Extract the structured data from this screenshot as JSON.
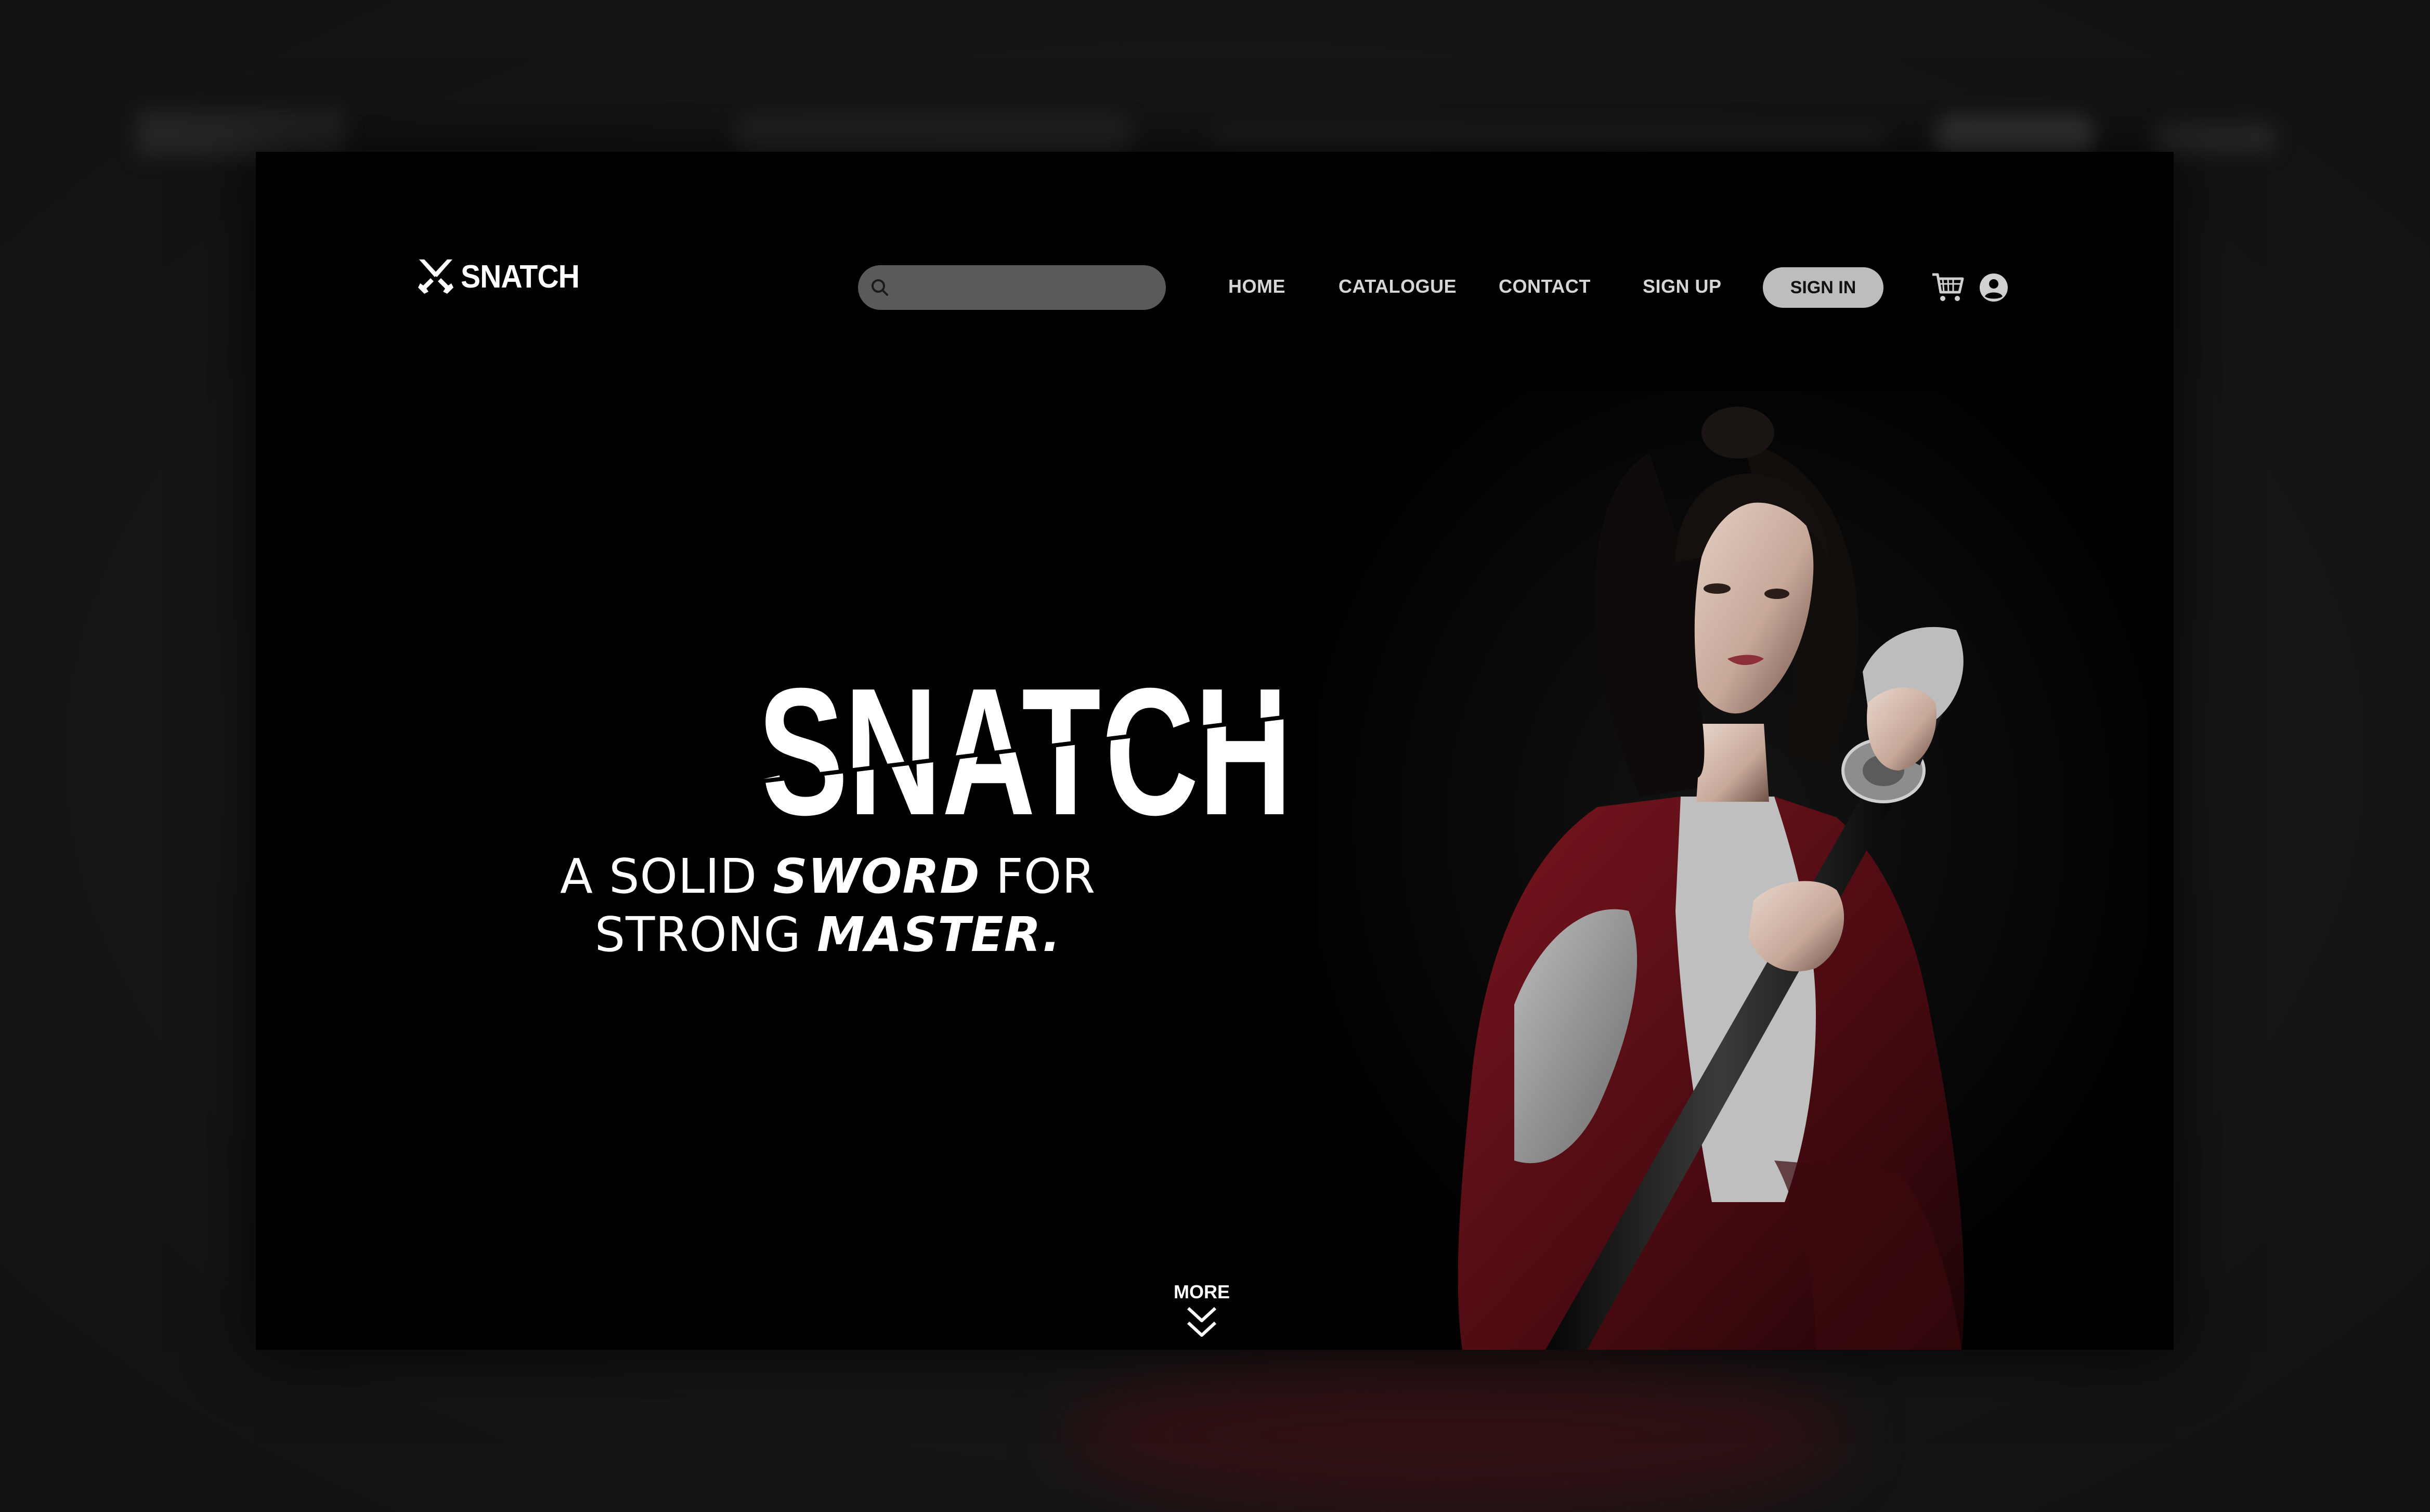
{
  "brand": {
    "name": "SNATCH",
    "logo_icon": "crossed-swords-icon"
  },
  "search": {
    "placeholder": "",
    "icon": "search-icon"
  },
  "nav": {
    "items": [
      {
        "label": "HOME"
      },
      {
        "label": "CATALOGUE"
      },
      {
        "label": "CONTACT"
      },
      {
        "label": "SIGN UP"
      }
    ],
    "signin_label": "SIGN IN",
    "cart_icon": "cart-icon",
    "account_icon": "user-account-icon"
  },
  "hero": {
    "title": "SNATCH",
    "tagline_line1_pre": "A SOLID ",
    "tagline_line1_bold": "SWORD",
    "tagline_line1_post": " FOR",
    "tagline_line2_pre": "STRONG ",
    "tagline_line2_bold": "MASTER.",
    "more_label": "MORE",
    "more_icon": "double-chevron-down-icon"
  },
  "colors": {
    "background": "#000000",
    "text": "#ffffff",
    "nav_text": "#d6d6d6",
    "search_bg": "#5a5a5a",
    "signin_bg": "#bdbdbd",
    "robe_red": "#5c0f16"
  }
}
